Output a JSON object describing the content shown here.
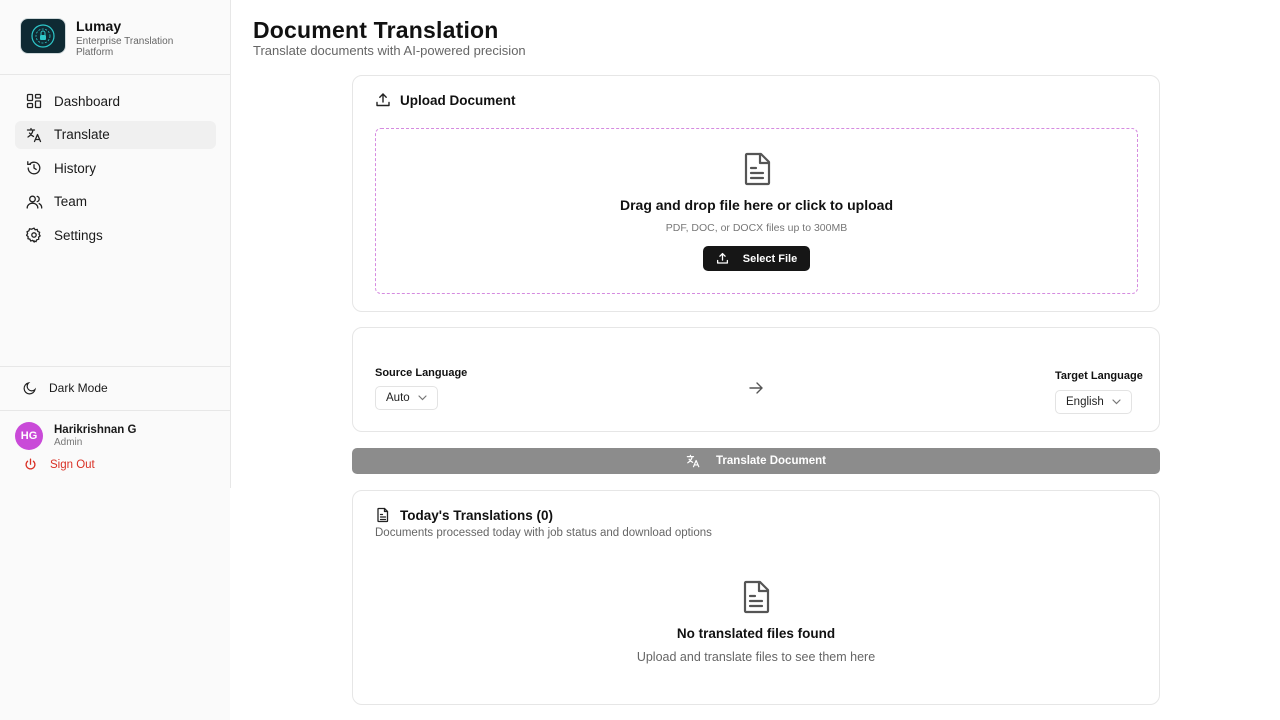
{
  "brand": {
    "title": "Lumay",
    "subtitle": "Enterprise Translation Platform"
  },
  "sidebar": {
    "items": [
      {
        "label": "Dashboard",
        "icon": "dashboard-icon",
        "active": false
      },
      {
        "label": "Translate",
        "icon": "translate-icon",
        "active": true
      },
      {
        "label": "History",
        "icon": "history-icon",
        "active": false
      },
      {
        "label": "Team",
        "icon": "team-icon",
        "active": false
      },
      {
        "label": "Settings",
        "icon": "gear-icon",
        "active": false
      }
    ],
    "dark_mode_label": "Dark Mode",
    "user": {
      "initials": "HG",
      "name": "Harikrishnan G",
      "role": "Admin"
    },
    "sign_out_label": "Sign Out"
  },
  "main": {
    "title": "Document Translation",
    "subtitle": "Translate documents with AI-powered precision",
    "upload": {
      "heading": "Upload Document",
      "dropzone_title": "Drag and drop file here or click to upload",
      "dropzone_hint": "PDF, DOC, or DOCX files up to 300MB",
      "select_button": "Select File"
    },
    "languages": {
      "source_label": "Source Language",
      "source_value": "Auto",
      "target_label": "Target Language",
      "target_value": "English"
    },
    "translate_button": "Translate Document",
    "today": {
      "heading": "Today's Translations (0)",
      "subtitle": "Documents processed today with job status and download options",
      "empty_title": "No translated files found",
      "empty_subtitle": "Upload and translate files to see them here"
    }
  },
  "colors": {
    "accent_dashed": "#d58be0",
    "avatar_bg": "#c94ad8",
    "sign_out": "#d93025",
    "primary_button": "#161616",
    "disabled_button": "#8c8c8c"
  }
}
